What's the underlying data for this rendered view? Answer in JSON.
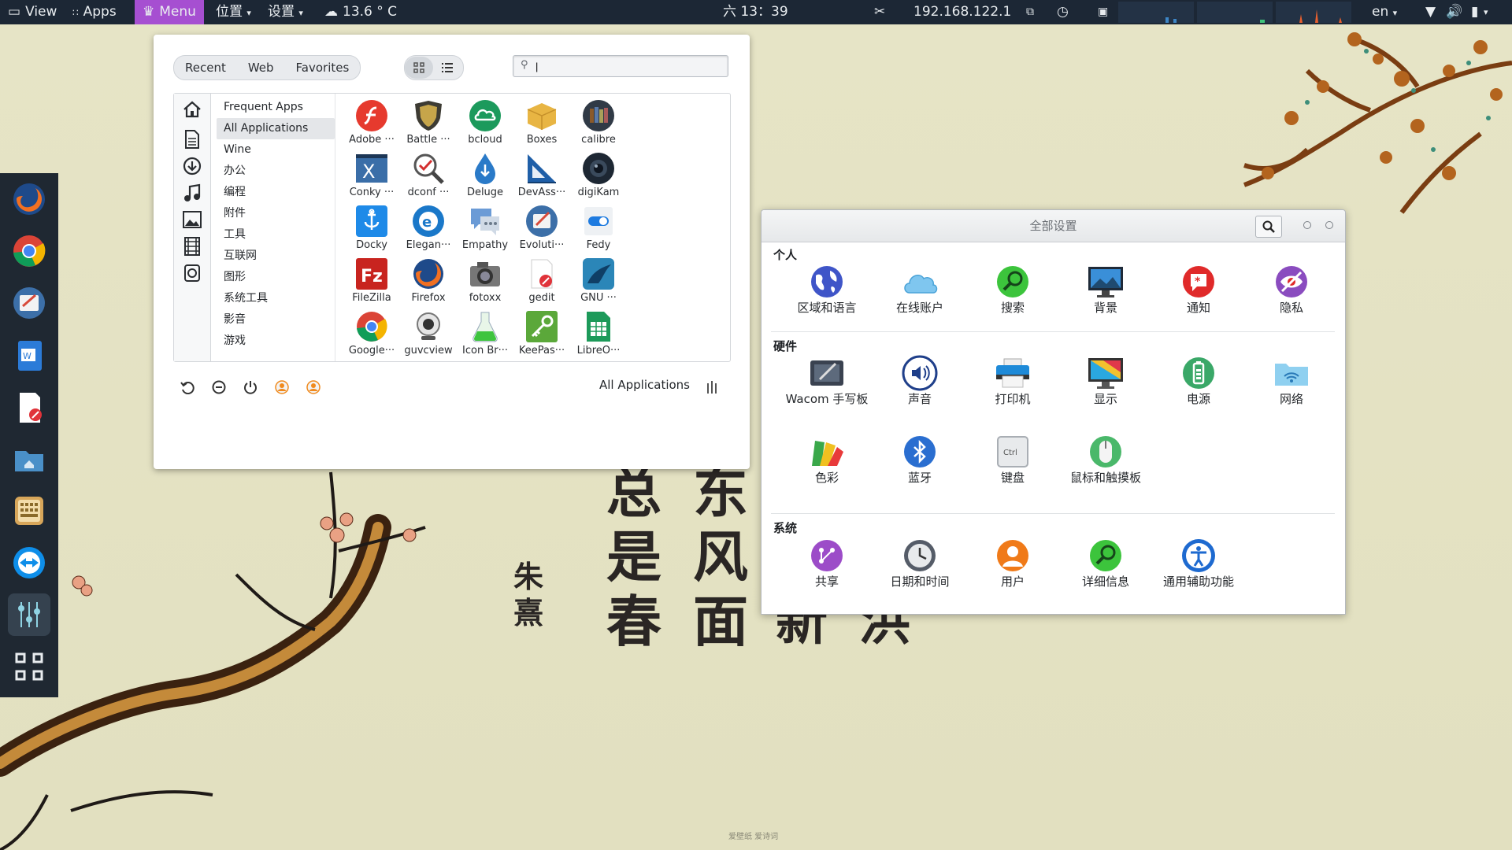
{
  "topbar": {
    "view": "View",
    "apps": "Apps",
    "menu": "Menu",
    "places": "位置",
    "settings": "设置",
    "weather": "13.6 ° C",
    "clock": "六 13：39",
    "ip": "192.168.122.1",
    "lang": "en"
  },
  "menu": {
    "tabs": [
      "Recent",
      "Web",
      "Favorites"
    ],
    "search_value": "|",
    "categories": [
      "Frequent Apps",
      "All Applications",
      "Wine",
      "办公",
      "编程",
      "附件",
      "工具",
      "互联网",
      "图形",
      "系统工具",
      "影音",
      "游戏"
    ],
    "apps": [
      "Adobe ···",
      "Battle ···",
      "bcloud",
      "Boxes",
      "calibre",
      "Conky ···",
      "dconf ···",
      "Deluge",
      "DevAss···",
      "digiKam",
      "Docky",
      "Elegan···",
      "Empathy",
      "Evoluti···",
      "Fedy",
      "FileZilla",
      "Firefox",
      "fotoxx",
      "gedit",
      "GNU ···",
      "Google···",
      "guvcview",
      "Icon Br···",
      "KeePas···",
      "LibreO···"
    ],
    "footer_label": "All Applications"
  },
  "settings_window": {
    "title": "全部设置",
    "sections": [
      {
        "title": "个人",
        "items": [
          "区域和语言",
          "在线账户",
          "搜索",
          "背景",
          "通知",
          "隐私"
        ]
      },
      {
        "title": "硬件",
        "items": [
          "Wacom 手写板",
          "声音",
          "打印机",
          "显示",
          "电源",
          "网络",
          "色彩",
          "蓝牙",
          "键盘",
          "鼠标和触摸板"
        ]
      },
      {
        "title": "系统",
        "items": [
          "共享",
          "日期和时间",
          "用户",
          "详细信息",
          "通用辅助功能"
        ]
      }
    ]
  },
  "wallpaper": {
    "col1": "朱熹",
    "col2": "总是春",
    "col3": "东风面",
    "col4": "新",
    "col5": "洪",
    "credit": "爱壁纸 爱诗词"
  }
}
